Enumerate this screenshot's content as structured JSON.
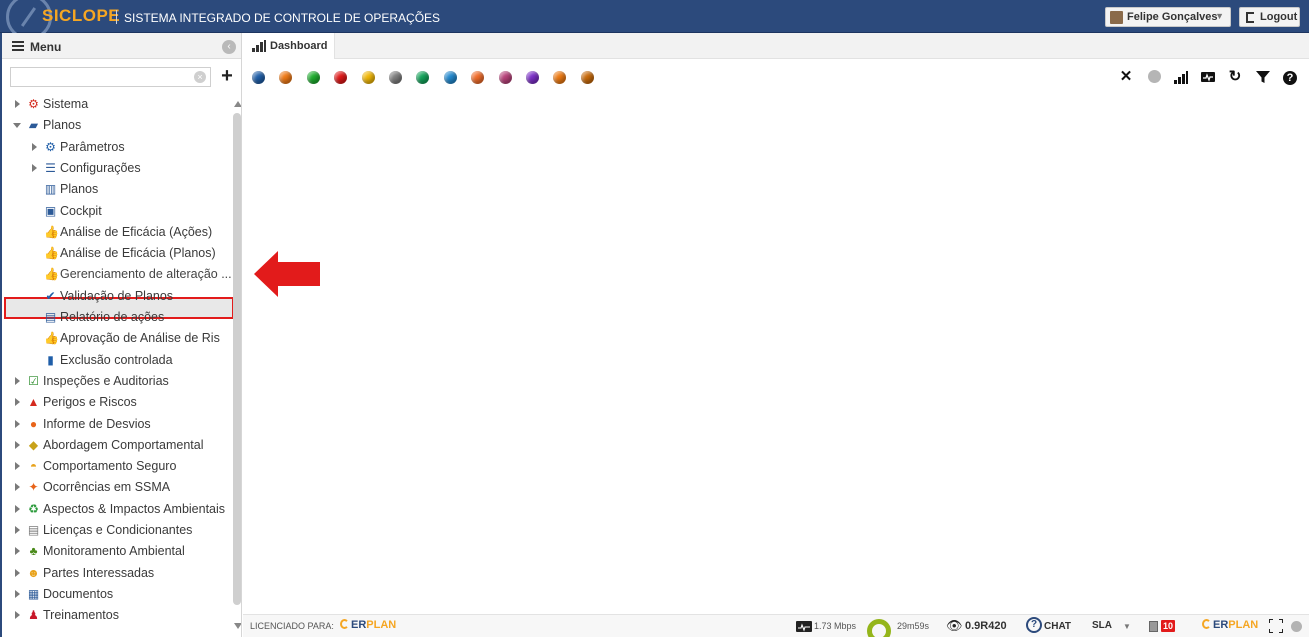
{
  "header": {
    "logo": "SICLOPE",
    "title": "SISTEMA INTEGRADO DE CONTROLE DE OPERAÇÕES",
    "user_name": "Felipe Gonçalves",
    "logout_label": "Logout"
  },
  "sidebar": {
    "menu_title": "Menu",
    "search_value": "",
    "items": [
      {
        "label": "Sistema",
        "level": 0,
        "expander": "right",
        "icon": "gear-red-icon"
      },
      {
        "label": "Planos",
        "level": 0,
        "expander": "down",
        "icon": "folder-icon"
      },
      {
        "label": "Parâmetros",
        "level": 1,
        "expander": "right",
        "icon": "gear-blue-icon"
      },
      {
        "label": "Configurações",
        "level": 1,
        "expander": "right",
        "icon": "sliders-icon"
      },
      {
        "label": "Planos",
        "level": 1,
        "expander": "none",
        "icon": "map-icon"
      },
      {
        "label": "Cockpit",
        "level": 1,
        "expander": "none",
        "icon": "cockpit-icon"
      },
      {
        "label": "Análise de Eficácia (Ações)",
        "level": 1,
        "expander": "none",
        "icon": "thumbs-up-icon"
      },
      {
        "label": "Análise de Eficácia (Planos)",
        "level": 1,
        "expander": "none",
        "icon": "thumbs-up-icon"
      },
      {
        "label": "Gerenciamento de alteração ...",
        "level": 1,
        "expander": "none",
        "icon": "thumbs-up-icon"
      },
      {
        "label": "Validação de Planos",
        "level": 1,
        "expander": "none",
        "icon": "check-icon"
      },
      {
        "label": "Relatório de ações",
        "level": 1,
        "expander": "none",
        "icon": "pdf-icon"
      },
      {
        "label": "Aprovação de Análise de Ris",
        "level": 1,
        "expander": "none",
        "icon": "thumbs-up-solid-icon"
      },
      {
        "label": "Exclusão controlada",
        "level": 1,
        "expander": "none",
        "icon": "trash-icon"
      },
      {
        "label": "Inspeções e Auditorias",
        "level": 0,
        "expander": "right",
        "icon": "clipboard-check-icon"
      },
      {
        "label": "Perigos e Riscos",
        "level": 0,
        "expander": "right",
        "icon": "warning-icon"
      },
      {
        "label": "Informe de Desvios",
        "level": 0,
        "expander": "right",
        "icon": "phone-icon"
      },
      {
        "label": "Abordagem Comportamental",
        "level": 0,
        "expander": "right",
        "icon": "diamond-sign-icon"
      },
      {
        "label": "Comportamento Seguro",
        "level": 0,
        "expander": "right",
        "icon": "hardhat-icon"
      },
      {
        "label": "Ocorrências em SSMA",
        "level": 0,
        "expander": "right",
        "icon": "falling-person-icon"
      },
      {
        "label": "Aspectos & Impactos Ambientais",
        "level": 0,
        "expander": "right",
        "icon": "recycle-icon"
      },
      {
        "label": "Licenças e Condicionantes",
        "level": 0,
        "expander": "right",
        "icon": "certificate-icon"
      },
      {
        "label": "Monitoramento Ambiental",
        "level": 0,
        "expander": "right",
        "icon": "tree-icon"
      },
      {
        "label": "Partes Interessadas",
        "level": 0,
        "expander": "right",
        "icon": "people-icon"
      },
      {
        "label": "Documentos",
        "level": 0,
        "expander": "right",
        "icon": "documents-icon"
      },
      {
        "label": "Treinamentos",
        "level": 0,
        "expander": "right",
        "icon": "trainer-icon"
      }
    ]
  },
  "tabs": [
    {
      "label": "Dashboard",
      "icon": "bar-chart-icon"
    }
  ],
  "toolbar": {
    "color_dots": [
      "#1f5ea8",
      "#f07a16",
      "#1fae2f",
      "#e01818",
      "#f2b807",
      "#7d7d7d",
      "#13a35a",
      "#2289cf",
      "#f26d2a",
      "#b8427a",
      "#7b2fc7",
      "#ee7a12",
      "#c96a0a"
    ],
    "icons": [
      "close-icon",
      "grey-dot-icon",
      "signal-bars-icon",
      "pulse-monitor-icon",
      "refresh-icon",
      "filter-icon",
      "help-icon"
    ]
  },
  "footer": {
    "license_label": "LICENCIADO PARA:",
    "erplan_left": "ER",
    "erplan_right": "PLAN",
    "speed": "1.73 Mbps",
    "timer": "29m59s",
    "version": "0.9R420",
    "chat_label": "CHAT",
    "sla_label": "SLA",
    "notification_count": "10"
  },
  "colors": {
    "header_bg": "#2c4a7c",
    "brand_orange": "#f5a623",
    "highlight_border": "#e21b1b",
    "arrow": "#e21b1b"
  }
}
